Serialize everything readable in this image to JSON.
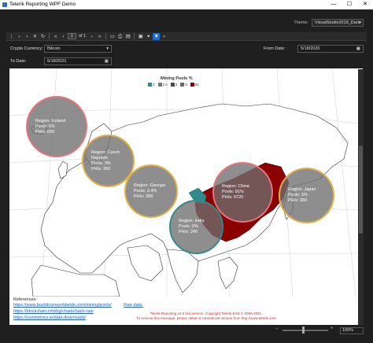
{
  "window": {
    "title": "Telerik Reporting WPF Demo",
    "minimize": "—",
    "maximize": "☐",
    "close": "✕"
  },
  "theme": {
    "label": "Theme:",
    "value": "VisualStudio2019_Dark"
  },
  "toolbar": {
    "page_current": "1",
    "page_of": "of 1"
  },
  "params": {
    "crypto_label": "Crypto Currency:",
    "crypto_value": "Bitcoin",
    "from_label": "From Date:",
    "from_value": "5/18/2020",
    "to_label": "To Date:",
    "to_value": "5/18/2021"
  },
  "chart": {
    "legend_title": "Mining Pools %",
    "legend": [
      {
        "label": "2",
        "color": "#2e8b8b"
      },
      {
        "label": "2.4",
        "color": "#7a7a7a"
      },
      {
        "label": "3",
        "color": "#4a4a4a"
      },
      {
        "label": "9",
        "color": "#6a6a6a"
      },
      {
        "label": "81",
        "color": "#8b0000"
      }
    ]
  },
  "chart_data": {
    "type": "map-bubble",
    "title": "Mining Pools %",
    "regions": [
      {
        "region": "Iceland",
        "pools": "5%",
        "phs": "600",
        "ring_color": "#e8737a"
      },
      {
        "region": "Czech Republic",
        "pools": "3%",
        "phs": "360",
        "ring_color": "#e0b04a"
      },
      {
        "region": "Georgia",
        "pools": "2.4%",
        "phs": "288",
        "ring_color": "#e0b04a"
      },
      {
        "region": "India",
        "pools": "2%",
        "phs": "240",
        "ring_color": "#2e8b8b"
      },
      {
        "region": "China",
        "pools": "81%",
        "phs": "9720",
        "ring_color": "#e8737a"
      },
      {
        "region": "Japan",
        "pools": "3%",
        "phs": "360",
        "ring_color": "#e0b04a"
      }
    ]
  },
  "references": {
    "title": "References:",
    "links": [
      "https://www.buybitcoinworldwide.com/mining/pools/",
      "https://blockchain.info/bg/charts/hash-rate",
      "https://coinmetrics.io/data-downloads/"
    ],
    "raw_data": "Raw data."
  },
  "trial": {
    "line1": "Telerik Reporting v2.5 trial version. Copyright Telerik EAD © 2006-2021.",
    "line2": "To remove this message, please obtain a commercial version from http://www.telerik.com"
  },
  "zoom": {
    "value": "100%"
  }
}
